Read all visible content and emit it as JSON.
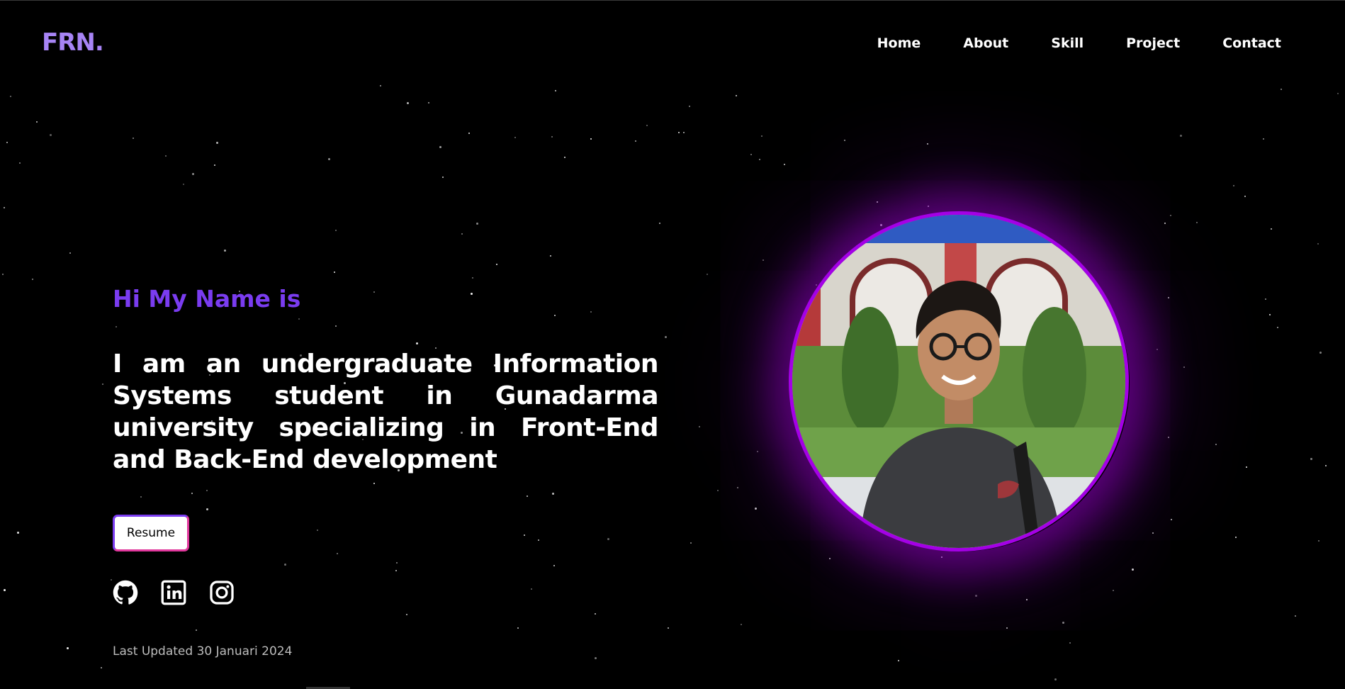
{
  "header": {
    "logo": "FRN.",
    "nav": [
      {
        "label": "Home"
      },
      {
        "label": "About"
      },
      {
        "label": "Skill"
      },
      {
        "label": "Project"
      },
      {
        "label": "Contact"
      }
    ]
  },
  "hero": {
    "greeting": "Hi My Name is",
    "tagline": "I am an undergraduate Information Systems student in Gunadarma university specializing in Front-End and Back-End development",
    "resume_label": "Resume",
    "socials": [
      {
        "icon": "github-icon"
      },
      {
        "icon": "linkedin-icon"
      },
      {
        "icon": "instagram-icon"
      }
    ],
    "last_updated": "Last Updated 30 Januari 2024"
  },
  "colors": {
    "background": "#000000",
    "logo": "#a784f5",
    "accent": "#7a3cf0",
    "photo_ring": "#a400e6",
    "button_border_alt": "#e0389c"
  }
}
